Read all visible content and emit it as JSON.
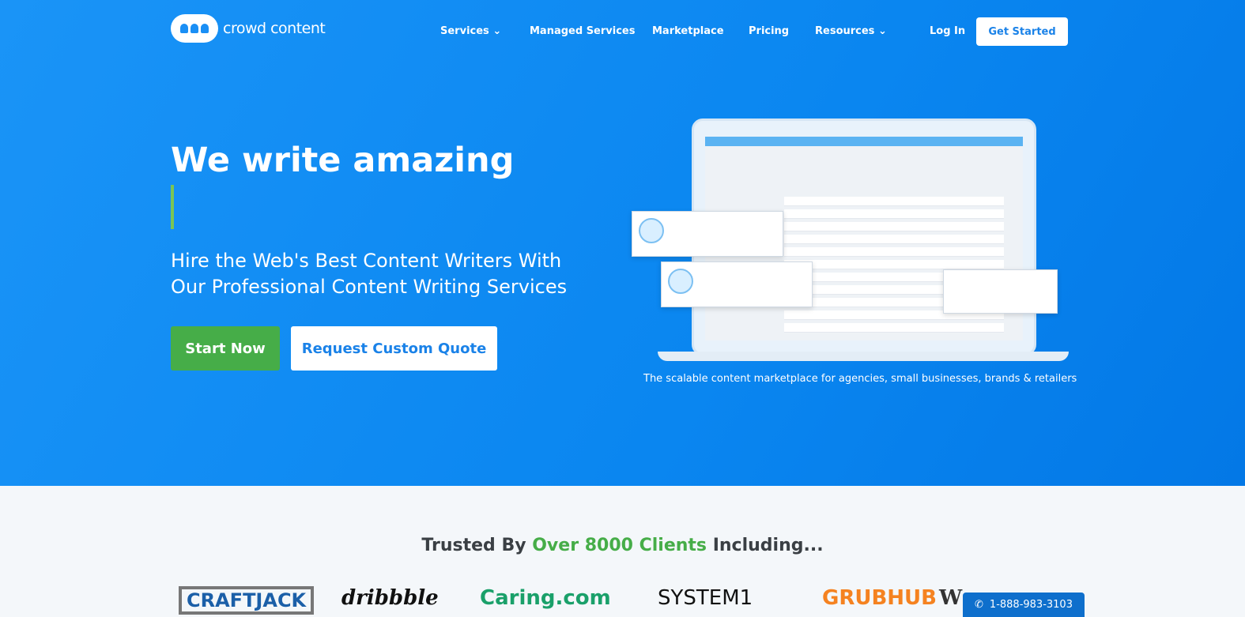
{
  "brand": {
    "name": "crowd content"
  },
  "nav": {
    "items": [
      "Services",
      "Managed Services",
      "Marketplace",
      "Pricing",
      "Resources"
    ],
    "login": "Log In",
    "get_started": "Get Started"
  },
  "hero": {
    "title": "We write amazing",
    "subtitle": "Hire the Web's Best Content Writers With Our Professional Content Writing Services",
    "start_now": "Start Now",
    "custom_quote": "Request Custom Quote",
    "caption": "The scalable content marketplace for agencies, small businesses, brands & retailers"
  },
  "trusted": {
    "prefix": "Trusted By ",
    "highlight": "Over 8000 Clients",
    "suffix": " Including..."
  },
  "clients": [
    "CRAFTJACK",
    "dribbble",
    "Caring.com",
    "SYSTEM1",
    "GRUBHUB",
    "W"
  ],
  "phone": "1-888-983-3103",
  "colors": {
    "primary": "#1a8ff5",
    "accent_green": "#46ad48"
  }
}
